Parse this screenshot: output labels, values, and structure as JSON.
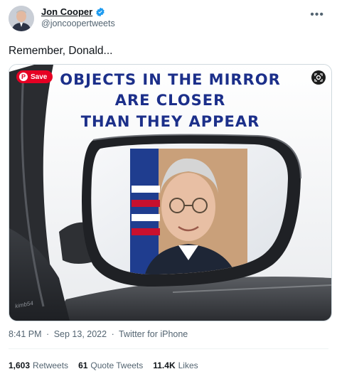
{
  "author": {
    "name": "Jon Cooper",
    "handle": "@joncoopertweets",
    "verified": true
  },
  "tweet": {
    "text": "Remember, Donald..."
  },
  "media": {
    "headline_lines": [
      "OBJECTS IN THE MIRROR",
      "ARE CLOSER",
      "THAN THEY APPEAR"
    ],
    "save_label": "Save",
    "watermark": "kimb54",
    "colors": {
      "headline": "#1c2f8a",
      "save_button": "#e60023"
    }
  },
  "meta": {
    "time": "8:41 PM",
    "date": "Sep 13, 2022",
    "source": "Twitter for iPhone",
    "separator": "·"
  },
  "stats": {
    "retweets_count": "1,603",
    "retweets_label": "Retweets",
    "quotes_count": "61",
    "quotes_label": "Quote Tweets",
    "likes_count": "11.4K",
    "likes_label": "Likes"
  }
}
